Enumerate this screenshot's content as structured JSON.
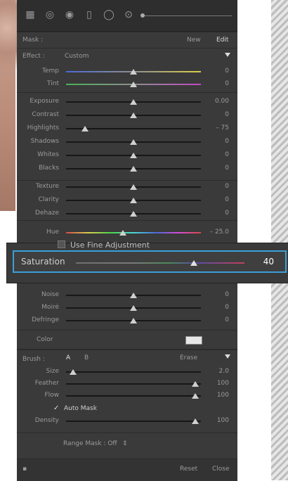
{
  "mask": {
    "label": "Mask :",
    "new": "New",
    "edit": "Edit"
  },
  "effect": {
    "label": "Effect :",
    "value": "Custom"
  },
  "sliders_group1": [
    {
      "name": "Temp",
      "value": "0",
      "pos": 0.5
    },
    {
      "name": "Tint",
      "value": "0",
      "pos": 0.5
    }
  ],
  "sliders_group2": [
    {
      "name": "Exposure",
      "value": "0.00",
      "pos": 0.5
    },
    {
      "name": "Contrast",
      "value": "0",
      "pos": 0.5
    },
    {
      "name": "Highlights",
      "value": "– 75",
      "pos": 0.14
    },
    {
      "name": "Shadows",
      "value": "0",
      "pos": 0.5
    },
    {
      "name": "Whites",
      "value": "0",
      "pos": 0.5
    },
    {
      "name": "Blacks",
      "value": "0",
      "pos": 0.5
    }
  ],
  "sliders_group3": [
    {
      "name": "Texture",
      "value": "0",
      "pos": 0.5
    },
    {
      "name": "Clarity",
      "value": "0",
      "pos": 0.5
    },
    {
      "name": "Dehaze",
      "value": "0",
      "pos": 0.5
    }
  ],
  "hue": {
    "name": "Hue",
    "value": "– 25.0",
    "pos": 0.42
  },
  "fine_adjustment": "Use Fine Adjustment",
  "saturation": {
    "name": "Saturation",
    "value": "40",
    "pos": 0.7
  },
  "sliders_group4": [
    {
      "name": "Noise",
      "value": "0",
      "pos": 0.5
    },
    {
      "name": "Moiré",
      "value": "0",
      "pos": 0.5
    },
    {
      "name": "Defringe",
      "value": "0",
      "pos": 0.5
    }
  ],
  "color": {
    "label": "Color"
  },
  "brush": {
    "label": "Brush :",
    "a": "A",
    "b": "B",
    "erase": "Erase",
    "sliders": [
      {
        "name": "Size",
        "value": "2.0",
        "pos": 0.05
      },
      {
        "name": "Feather",
        "value": "100",
        "pos": 0.96
      },
      {
        "name": "Flow",
        "value": "100",
        "pos": 0.96
      }
    ],
    "auto_mask": "Auto Mask",
    "density": {
      "name": "Density",
      "value": "100",
      "pos": 0.96
    }
  },
  "range_mask": "Range Mask : Off",
  "footer": {
    "reset": "Reset",
    "close": "Close"
  }
}
